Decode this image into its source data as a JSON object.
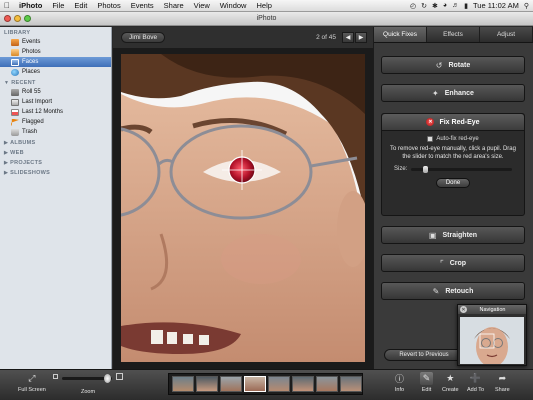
{
  "menubar": {
    "app_name": "iPhoto",
    "items": [
      "File",
      "Edit",
      "Photos",
      "Events",
      "Share",
      "View",
      "Window",
      "Help"
    ],
    "clock": "Tue 11:02 AM"
  },
  "window": {
    "title": "iPhoto"
  },
  "sidebar": {
    "sections": {
      "library": "LIBRARY",
      "recent": "RECENT",
      "albums": "ALBUMS",
      "web": "WEB",
      "projects": "PROJECTS",
      "slideshows": "SLIDESHOWS"
    },
    "library_items": [
      "Events",
      "Photos",
      "Faces",
      "Places"
    ],
    "recent_items": [
      "Roll 55",
      "Last Import",
      "Last 12 Months",
      "Flagged",
      "Trash"
    ],
    "selected": "Faces"
  },
  "viewer": {
    "event_name": "Jimi Bove",
    "counter": "2 of 45"
  },
  "edit_panel": {
    "tabs": [
      "Quick Fixes",
      "Effects",
      "Adjust"
    ],
    "active_tab": "Quick Fixes",
    "rotate": "Rotate",
    "enhance": "Enhance",
    "fix_red_eye": "Fix Red-Eye",
    "auto_fix": "Auto-fix red-eye",
    "instructions": "To remove red-eye manually, click a pupil. Drag the slider to match the red area's size.",
    "size_label": "Size:",
    "size_value": 0.12,
    "done": "Done",
    "straighten": "Straighten",
    "crop": "Crop",
    "retouch": "Retouch",
    "revert": "Revert to Previous"
  },
  "navigation": {
    "title": "Navigation"
  },
  "toolbar": {
    "full_screen": "Full Screen",
    "zoom": "Zoom",
    "zoom_value": 0.9,
    "info": "Info",
    "edit": "Edit",
    "create": "Create",
    "add_to": "Add To",
    "share": "Share"
  },
  "icons": {
    "apple": "apple-logo-icon",
    "rotate": "rotate-icon",
    "enhance": "magic-wand-icon",
    "red_eye": "red-eye-icon",
    "straighten": "straighten-icon",
    "crop": "crop-icon",
    "retouch": "bandage-icon"
  },
  "colors": {
    "selection": "#3e6fb8",
    "panel_bg": "#3a3a3a",
    "red_eye": "#a31111"
  }
}
